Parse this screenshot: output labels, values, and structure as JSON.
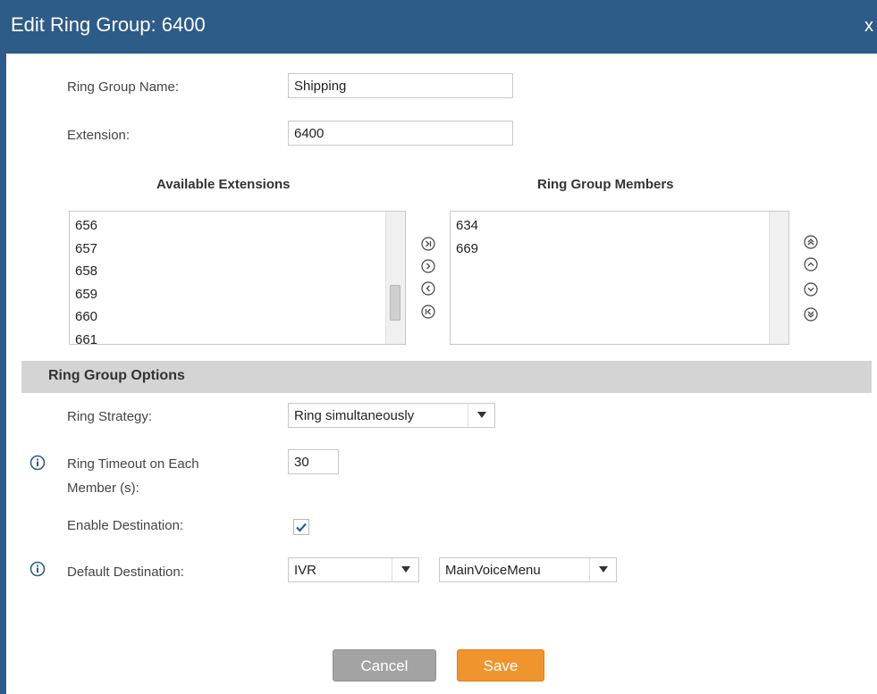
{
  "dialog": {
    "title": "Edit Ring Group: 6400",
    "close_label": "x"
  },
  "form": {
    "ring_group_name": {
      "label": "Ring Group Name:",
      "value": "Shipping"
    },
    "extension": {
      "label": "Extension:",
      "value": "6400"
    }
  },
  "available": {
    "heading": "Available Extensions",
    "items": [
      "656",
      "657",
      "658",
      "659",
      "660",
      "661"
    ]
  },
  "members": {
    "heading": "Ring Group Members",
    "items": [
      "634",
      "669"
    ]
  },
  "options": {
    "heading": "Ring Group Options",
    "ring_strategy": {
      "label": "Ring Strategy:",
      "value": "Ring simultaneously"
    },
    "ring_timeout": {
      "label_line1": "Ring Timeout on Each",
      "label_line2": "Member (s):",
      "value": "30"
    },
    "enable_destination": {
      "label": "Enable Destination:",
      "checked": true
    },
    "default_destination": {
      "label": "Default Destination:",
      "type_value": "IVR",
      "target_value": "MainVoiceMenu"
    }
  },
  "buttons": {
    "cancel": "Cancel",
    "save": "Save"
  },
  "colors": {
    "titlebar": "#2e5c88",
    "section_bar": "#d4d4d4",
    "cancel": "#a3a3a3",
    "save": "#f0952e",
    "info_icon": "#2e5c88"
  }
}
